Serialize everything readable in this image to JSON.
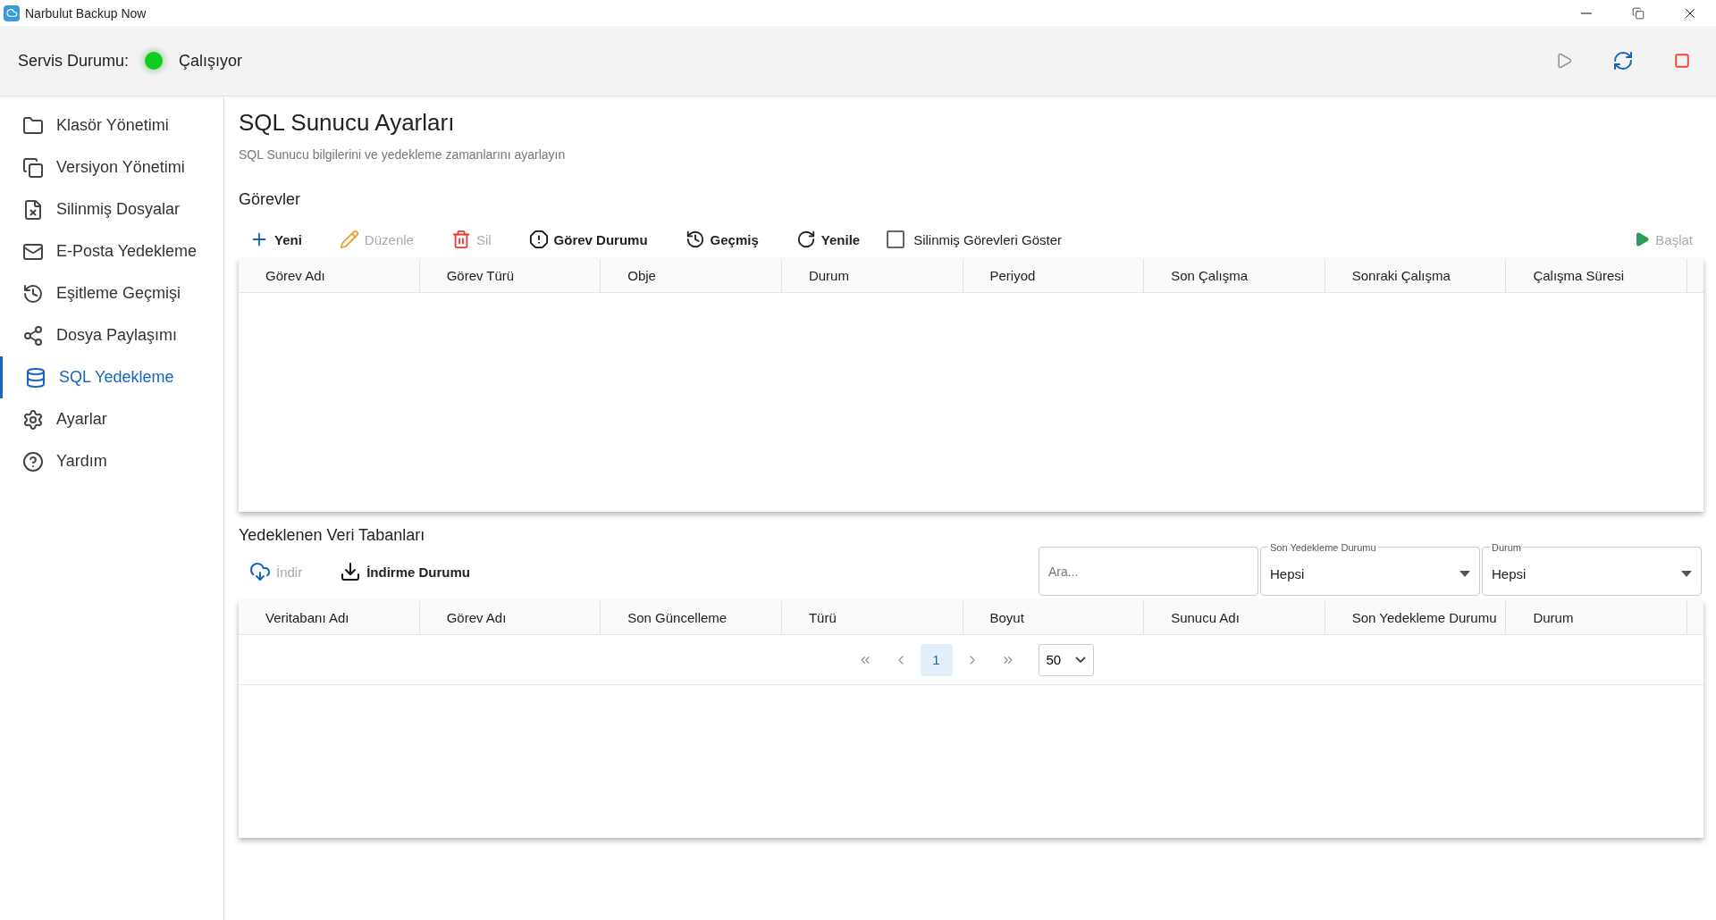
{
  "window": {
    "title": "Narbulut Backup Now"
  },
  "service": {
    "label": "Servis Durumu:",
    "running": true,
    "status": "Çalışıyor"
  },
  "sidebar": {
    "items": [
      {
        "label": "Klasör Yönetimi",
        "selected": false
      },
      {
        "label": "Versiyon Yönetimi",
        "selected": false
      },
      {
        "label": "Silinmiş Dosyalar",
        "selected": false
      },
      {
        "label": "E-Posta Yedekleme",
        "selected": false
      },
      {
        "label": "Eşitleme Geçmişi",
        "selected": false
      },
      {
        "label": "Dosya Paylaşımı",
        "selected": false
      },
      {
        "label": "SQL Yedekleme",
        "selected": true
      },
      {
        "label": "Ayarlar",
        "selected": false
      },
      {
        "label": "Yardım",
        "selected": false
      }
    ]
  },
  "page": {
    "title": "SQL Sunucu Ayarları",
    "subtitle": "SQL Sunucu bilgilerini ve yedekleme zamanlarını ayarlayın"
  },
  "tasks": {
    "title": "Görevler",
    "toolbar": [
      {
        "label": "Yeni",
        "disabled": false
      },
      {
        "label": "Düzenle",
        "disabled": true
      },
      {
        "label": "Sil",
        "disabled": true
      },
      {
        "label": "Görev Durumu",
        "disabled": false
      },
      {
        "label": "Geçmiş",
        "disabled": false
      },
      {
        "label": "Yenile",
        "disabled": false
      }
    ],
    "show_deleted": {
      "label": "Silinmiş Görevleri Göster",
      "checked": false
    },
    "start": {
      "label": "Başlat",
      "disabled": true
    },
    "columns": [
      "Görev Adı",
      "Görev Türü",
      "Obje",
      "Durum",
      "Periyod",
      "Son Çalışma",
      "Sonraki Çalışma",
      "Çalışma Süresi"
    ]
  },
  "databases": {
    "title": "Yedeklenen Veri Tabanları",
    "toolbar": [
      {
        "label": "İndir",
        "disabled": true
      },
      {
        "label": "İndirme Durumu",
        "disabled": false
      }
    ],
    "search": {
      "placeholder": "Ara..."
    },
    "filters": [
      {
        "label": "Son Yedekleme Durumu",
        "value": "Hepsi"
      },
      {
        "label": "Durum",
        "value": "Hepsi"
      }
    ],
    "columns": [
      "Veritabanı Adı",
      "Görev Adı",
      "Son Güncelleme",
      "Türü",
      "Boyut",
      "Sunucu Adı",
      "Son Yedekleme Durumu",
      "Durum"
    ],
    "pagination": {
      "pages": [
        {
          "label": "1",
          "selected": true
        }
      ],
      "page_size": "50"
    }
  }
}
